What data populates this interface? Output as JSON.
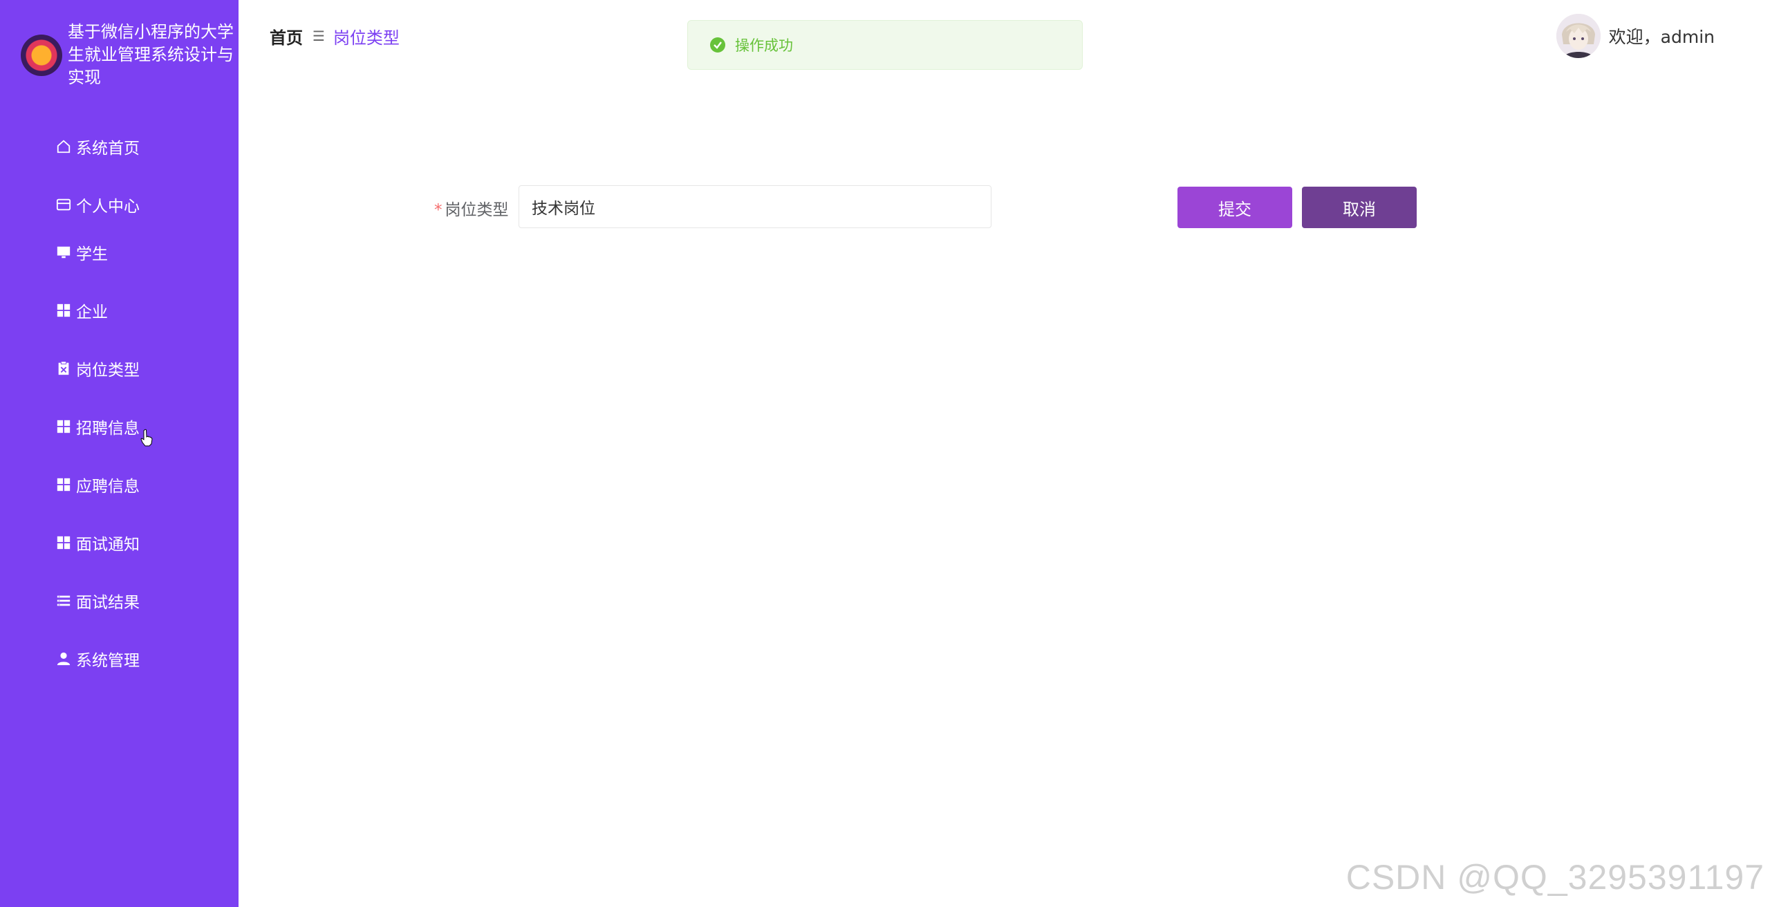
{
  "app": {
    "title": "基于微信小程序的大学生就业管理系统设计与实现"
  },
  "sidebar": {
    "items": [
      {
        "label": "系统首页",
        "icon": "home-icon"
      },
      {
        "label": "个人中心",
        "icon": "card-icon"
      },
      {
        "label": "学生",
        "icon": "monitor-icon"
      },
      {
        "label": "企业",
        "icon": "grid-icon"
      },
      {
        "label": "岗位类型",
        "icon": "clipboard-icon"
      },
      {
        "label": "招聘信息",
        "icon": "grid-icon"
      },
      {
        "label": "应聘信息",
        "icon": "grid-icon"
      },
      {
        "label": "面试通知",
        "icon": "grid-icon"
      },
      {
        "label": "面试结果",
        "icon": "list-icon"
      },
      {
        "label": "系统管理",
        "icon": "user-icon"
      }
    ]
  },
  "breadcrumb": {
    "home": "首页",
    "separator": "☰",
    "current": "岗位类型"
  },
  "toast": {
    "text": "操作成功",
    "type": "success"
  },
  "header": {
    "welcome": "欢迎，admin"
  },
  "form": {
    "label": "岗位类型",
    "required_mark": "*",
    "value": "技术岗位",
    "submit_label": "提交",
    "cancel_label": "取消"
  },
  "watermark": "CSDN @QQ_3295391197",
  "colors": {
    "sidebar_bg": "#7c40f2",
    "accent": "#7c40f2",
    "submit": "#9b45d6",
    "cancel": "#6f3f93",
    "success": "#67c23a"
  }
}
